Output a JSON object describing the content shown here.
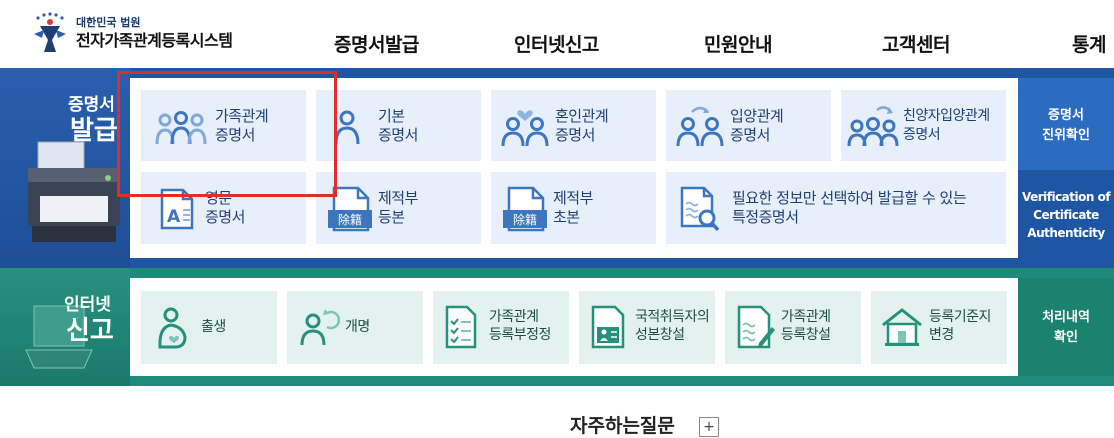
{
  "header": {
    "org_sub": "대한민국 법원",
    "org_main": "전자가족관계등록시스템",
    "nav": [
      "증명서발급",
      "인터넷신고",
      "민원안내",
      "고객센터",
      "통계"
    ]
  },
  "issuance": {
    "label_small": "증명서",
    "label_big": "발급",
    "cards": [
      {
        "label": "가족관계\n증명서",
        "icon": "family-three-icon"
      },
      {
        "label": "기본\n증명서",
        "icon": "person-icon"
      },
      {
        "label": "혼인관계\n증명서",
        "icon": "marriage-icon"
      },
      {
        "label": "입양관계\n증명서",
        "icon": "adoption-icon"
      },
      {
        "label": "친양자입양관계\n증명서",
        "icon": "full-adoption-icon"
      },
      {
        "label": "영문\n증명서",
        "icon": "english-doc-icon"
      },
      {
        "label": "제적부\n등본",
        "icon": "removed-register-icon"
      },
      {
        "label": "제적부\n초본",
        "icon": "removed-register-icon"
      },
      {
        "label": "필요한 정보만 선택하여 발급할 수 있는\n특정증명서",
        "icon": "doc-search-icon"
      }
    ],
    "side_top": "증명서\n진위확인",
    "side_bottom": "Verification of\nCertificate\nAuthenticity",
    "doc_glyph": "除籍"
  },
  "report": {
    "label_small": "인터넷",
    "label_big": "신고",
    "cards": [
      {
        "label": "출생",
        "icon": "birth-icon"
      },
      {
        "label": "개명",
        "icon": "rename-icon"
      },
      {
        "label": "가족관계\n등록부정정",
        "icon": "checklist-icon"
      },
      {
        "label": "국적취득자의\n성본창설",
        "icon": "id-card-icon"
      },
      {
        "label": "가족관계\n등록창설",
        "icon": "doc-pen-icon"
      },
      {
        "label": "등록기준지\n변경",
        "icon": "house-icon"
      }
    ],
    "side": "처리내역\n확인"
  },
  "faq": {
    "title": "자주하는질문",
    "plus": "+"
  },
  "colors": {
    "blue": "#1f56a4",
    "teal": "#1f8a79",
    "highlight": "#e12b2f"
  }
}
